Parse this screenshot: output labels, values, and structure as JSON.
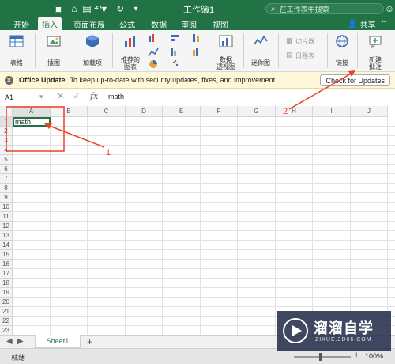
{
  "titlebar": {
    "title": "工作簿1",
    "search_placeholder": "在工作表中搜索",
    "colors": {
      "green": "#217346"
    }
  },
  "tabs": [
    {
      "label": "开始",
      "active": false
    },
    {
      "label": "插入",
      "active": true
    },
    {
      "label": "页面布局",
      "active": false
    },
    {
      "label": "公式",
      "active": false
    },
    {
      "label": "数据",
      "active": false
    },
    {
      "label": "审阅",
      "active": false
    },
    {
      "label": "视图",
      "active": false
    }
  ],
  "share_label": "共享",
  "ribbon": {
    "table": "表格",
    "illustrations": "插图",
    "addins": "加载项",
    "recommended_charts": [
      "推荐的",
      "图表"
    ],
    "pivotchart": [
      "数据",
      "透视图"
    ],
    "sparklines": "迷你图",
    "slicer": "切片器",
    "timeline": "日程表",
    "link": "链接",
    "new_comment": [
      "新建",
      "批注"
    ]
  },
  "update_bar": {
    "title": "Office Update",
    "message": "To keep up-to-date with security updates, fixes, and improvement...",
    "button": "Check for Updates"
  },
  "formula_bar": {
    "name_box": "A1",
    "fx": "fx",
    "value": "math"
  },
  "grid": {
    "columns": [
      "A",
      "B",
      "C",
      "D",
      "E",
      "F",
      "G",
      "H",
      "I",
      "J"
    ],
    "rows": [
      "1",
      "2",
      "3",
      "4",
      "5",
      "6",
      "7",
      "8",
      "9",
      "10",
      "11",
      "12",
      "13",
      "14",
      "15",
      "16",
      "17",
      "18",
      "19",
      "20",
      "21",
      "22",
      "23"
    ],
    "cell_a1": "math"
  },
  "annotations": {
    "label1": "1",
    "label2": "2",
    "color": "#e8412c"
  },
  "sheets": {
    "active": "Sheet1",
    "add": "+"
  },
  "status": {
    "text": "就绪",
    "zoom": "100%"
  },
  "watermark": {
    "brand": "溜溜自学",
    "url": "ZIXUE.3D66.COM"
  }
}
